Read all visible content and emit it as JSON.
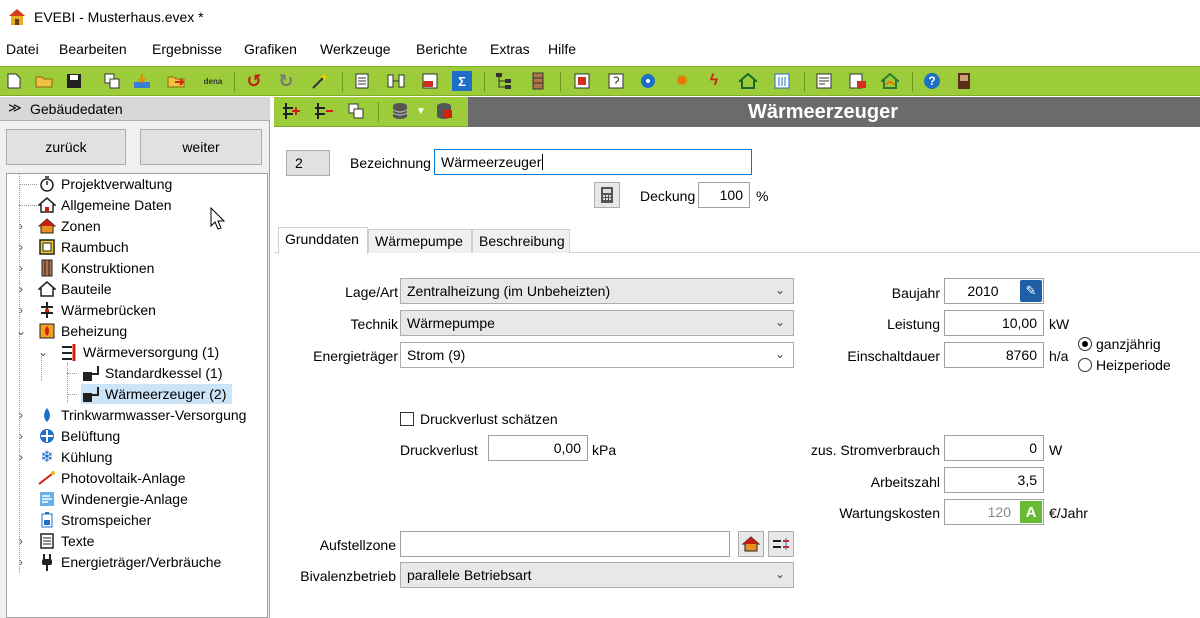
{
  "window": {
    "title": "EVEBI - Musterhaus.evex *"
  },
  "menu": [
    "Datei",
    "Bearbeiten",
    "Ergebnisse",
    "Grafiken",
    "Werkzeuge",
    "Berichte",
    "Extras",
    "Hilfe"
  ],
  "toolbar": {
    "dena_label": "dena"
  },
  "left": {
    "header": "Gebäudedaten",
    "back": "zurück",
    "next": "weiter",
    "tree": [
      {
        "label": "Projektverwaltung"
      },
      {
        "label": "Allgemeine Daten"
      },
      {
        "label": "Zonen"
      },
      {
        "label": "Raumbuch"
      },
      {
        "label": "Konstruktionen"
      },
      {
        "label": "Bauteile"
      },
      {
        "label": "Wärmebrücken"
      },
      {
        "label": "Beheizung"
      },
      {
        "label": "Wärmeversorgung (1)"
      },
      {
        "label": "Standardkessel (1)"
      },
      {
        "label": "Wärmeerzeuger (2)"
      },
      {
        "label": "Trinkwarmwasser-Versorgung"
      },
      {
        "label": "Belüftung"
      },
      {
        "label": "Kühlung"
      },
      {
        "label": "Photovoltaik-Anlage"
      },
      {
        "label": "Windenergie-Anlage"
      },
      {
        "label": "Stromspeicher"
      },
      {
        "label": "Texte"
      },
      {
        "label": "Energieträger/Verbräuche"
      }
    ]
  },
  "header": {
    "title": "Wärmeerzeuger"
  },
  "form": {
    "id": "2",
    "bezeichnung_label": "Bezeichnung",
    "bezeichnung_value": "Wärmeerzeuger",
    "deckung_label": "Deckung",
    "deckung_value": "100",
    "deckung_unit": "%",
    "tabs": [
      "Grunddaten",
      "Wärmepumpe",
      "Beschreibung"
    ],
    "lage_label": "Lage/Art",
    "lage_value": "Zentralheizung (im Unbeheizten)",
    "technik_label": "Technik",
    "technik_value": "Wärmepumpe",
    "energietraeger_label": "Energieträger",
    "energietraeger_value": "Strom (9)",
    "baujahr_label": "Baujahr",
    "baujahr_value": "2010",
    "leistung_label": "Leistung",
    "leistung_value": "10,00",
    "leistung_unit": "kW",
    "einschalt_label": "Einschaltdauer",
    "einschalt_value": "8760",
    "einschalt_unit": "h/a",
    "radio_ganz": "ganzjährig",
    "radio_heiz": "Heizperiode",
    "druck_schaetzen": "Druckverlust schätzen",
    "druckverlust_label": "Druckverlust",
    "druckverlust_value": "0,00",
    "druckverlust_unit": "kPa",
    "strom_label": "zus. Stromverbrauch",
    "strom_value": "0",
    "strom_unit": "W",
    "arbeitszahl_label": "Arbeitszahl",
    "arbeitszahl_value": "3,5",
    "wartung_label": "Wartungskosten",
    "wartung_value": "120",
    "wartung_badge": "A",
    "wartung_unit": "€/Jahr",
    "aufstell_label": "Aufstellzone",
    "aufstell_value": "",
    "bivalenz_label": "Bivalenzbetrieb",
    "bivalenz_value": "parallele Betriebsart"
  },
  "colors": {
    "toolbar_green": "#9ccc3a",
    "header_gray": "#6b6b6b",
    "selection": "#cce4f7",
    "accent_blue": "#0078d7"
  }
}
